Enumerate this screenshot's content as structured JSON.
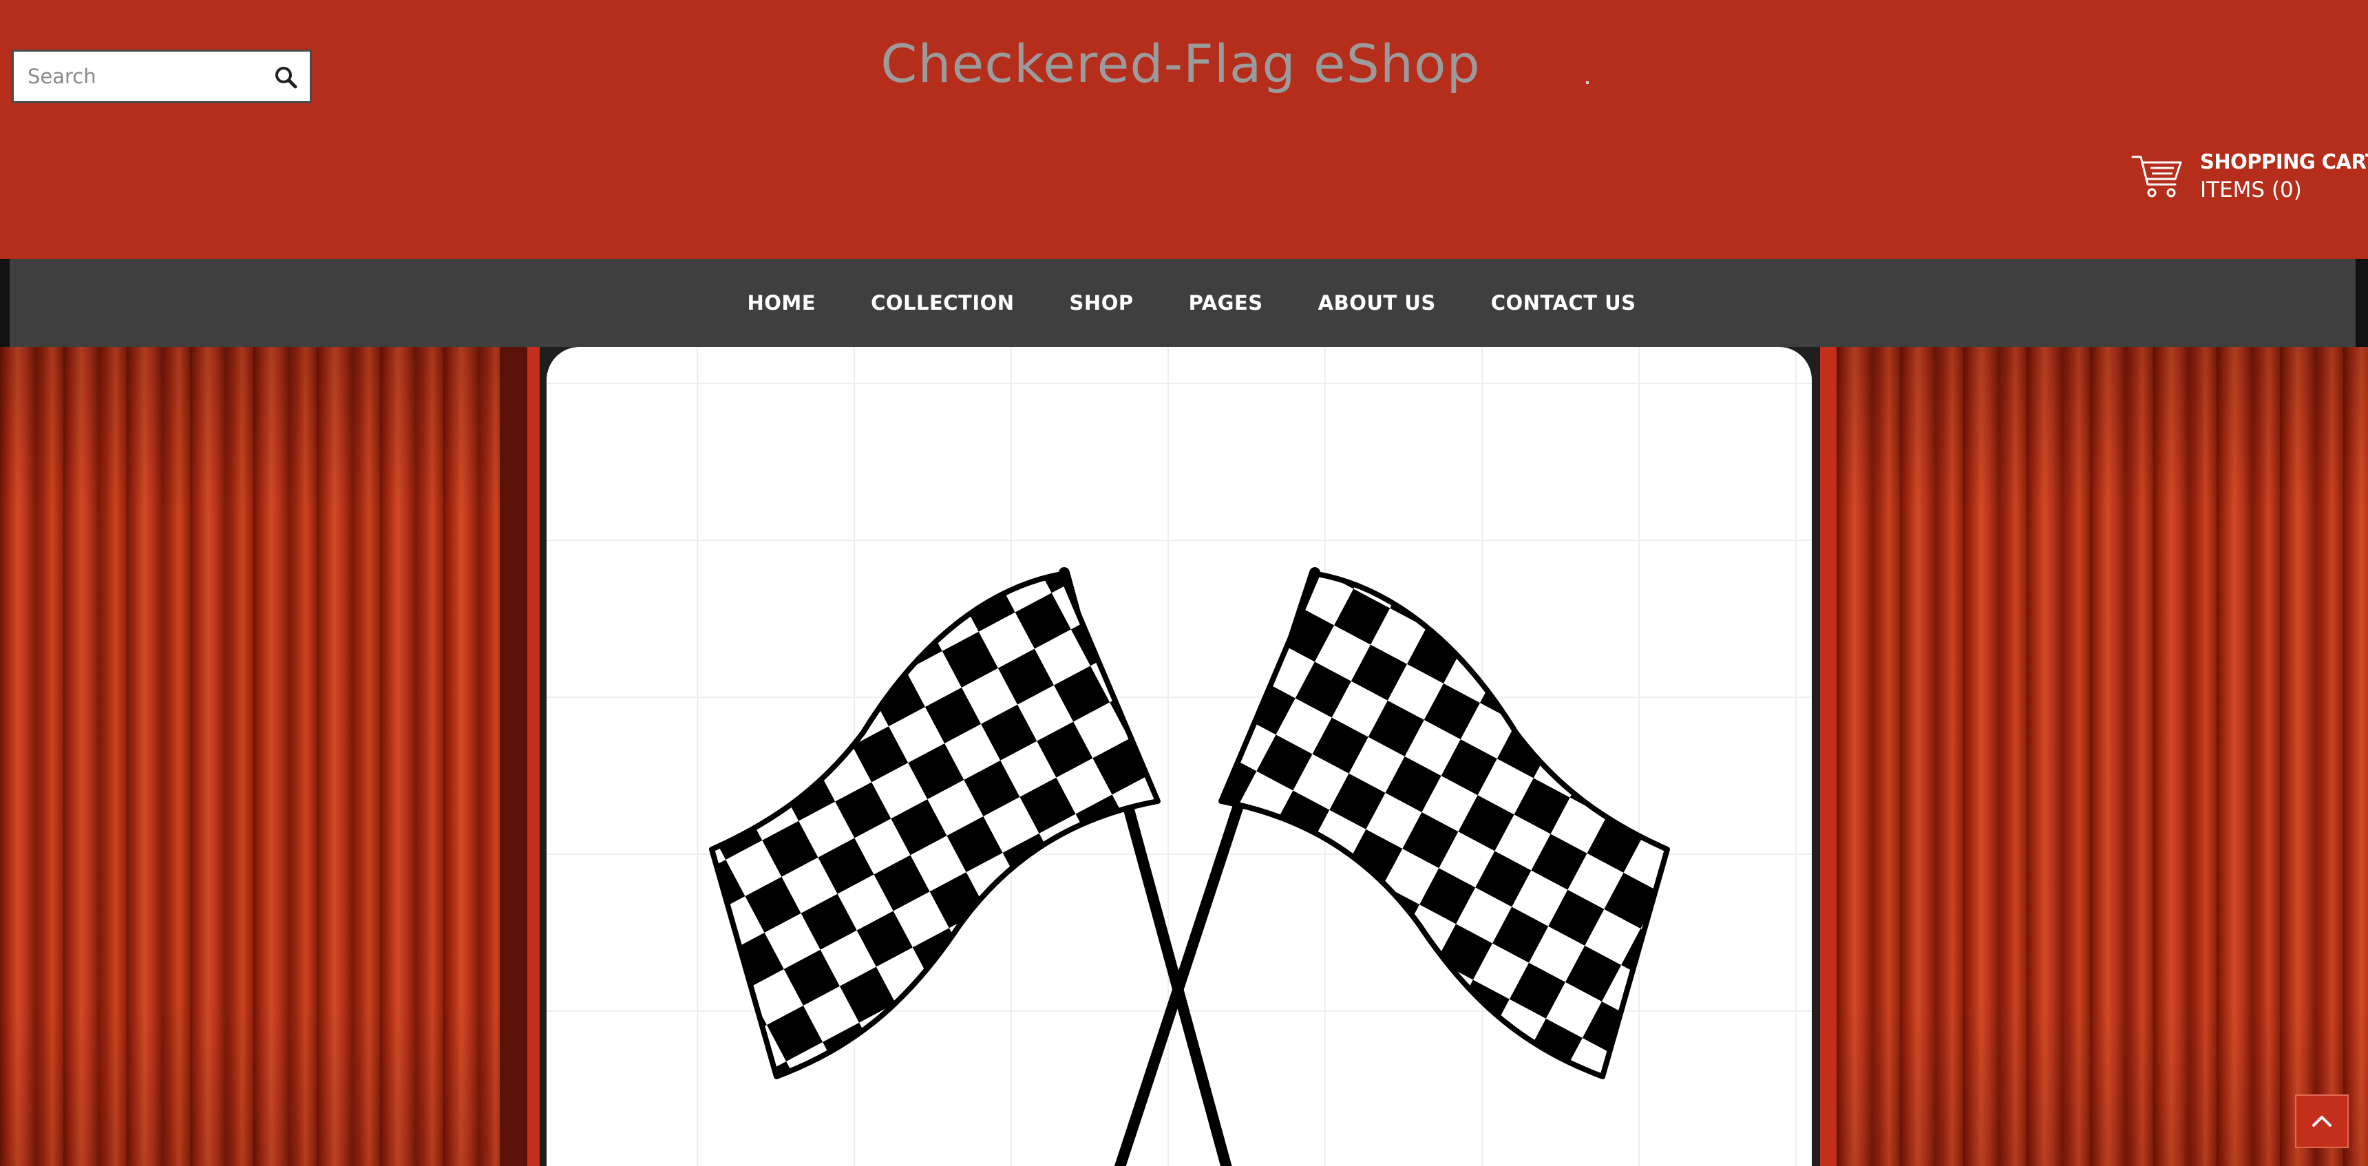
{
  "header": {
    "search": {
      "placeholder": "Search",
      "value": "",
      "icon": "search-icon"
    },
    "logo": {
      "title": "Checkered-Flag eShop"
    },
    "cart": {
      "title": "SHOPPING CART",
      "items_label": "ITEMS (0)",
      "icon": "shopping-cart-icon"
    }
  },
  "nav": {
    "items": [
      {
        "label": "HOME"
      },
      {
        "label": "COLLECTION"
      },
      {
        "label": "SHOP"
      },
      {
        "label": "PAGES"
      },
      {
        "label": "ABOUT US"
      },
      {
        "label": "CONTACT US"
      }
    ]
  },
  "hero": {
    "image": "checkered-flags",
    "background": "red-curtains"
  },
  "back_to_top": {
    "icon": "chevron-up-icon"
  },
  "colors": {
    "header_bg": "#b52d1b",
    "nav_bg": "#3f3f3f",
    "logo_text": "#9b9b9b",
    "accent": "#c42f1c"
  }
}
